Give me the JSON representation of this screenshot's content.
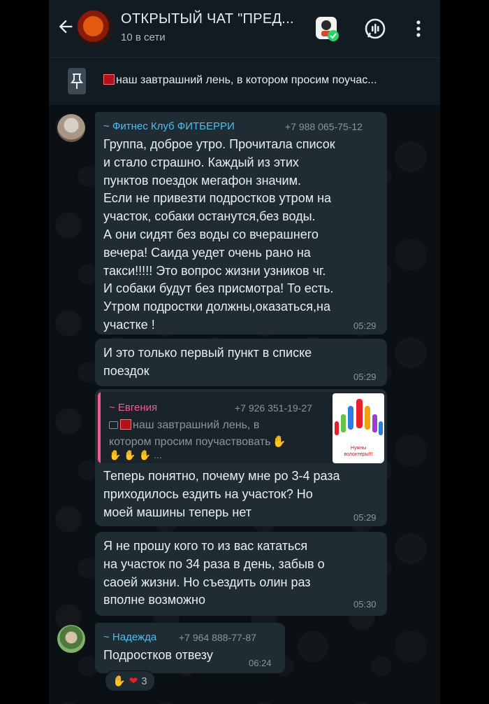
{
  "header": {
    "title": "ОТКРЫТЫЙ ЧАТ \"ПРЕД...",
    "subtitle": "10 в сети"
  },
  "pinned": {
    "text": "наш завтрашний лень, в котором просим поучас..."
  },
  "messages": [
    {
      "sender": "~ Фитнес Клуб ФИТБЕРРИ",
      "phone": "+7 988 065-75-12",
      "text": "Группа, доброе утро. Прочитала список\nи стало страшно. Каждый из этих\nпунктов поездок мегафон значим.\nЕсли не привезти подростков утром на\nучасток, собаки останутся,без воды.\nА они сидят без воды со вчерашнего\nвечера! Саида уедет очень рано на\nтакси!!!!! Это вопрос жизни узников чг.\nИ собаки будут без присмотра! То есть.\nУтром подростки должны,оказаться,на\nучастке !",
      "time": "05:29"
    },
    {
      "text": "И это только первый пункт в списке\nпоездок",
      "time": "05:29"
    },
    {
      "quote_sender": "~ Евгения",
      "quote_phone": "+7 926 351-19-27",
      "quote_text_1": "наш завтрашний лень, в",
      "quote_text_2": "котором просим поучаствовать",
      "quote_text_3": "...",
      "quote_image_caption": "Нужны волонтеры!!!",
      "text": "Теперь понятно, почему мне ро 3-4 раза\nприходилось ездить на участок? Но\nмоей машины теперь нет",
      "time": "05:29"
    },
    {
      "text": "Я не прошу кого то из вас кататься\nна участок по 34 раза в день, забыв о\nсаоей жизни. Но  съездить олин раз\nвполне возможно",
      "time": "05:30"
    },
    {
      "sender": "~ Надежда",
      "phone": "+7 964 888-77-87",
      "text": "Подростков отвезу",
      "time": "06:24",
      "reaction_count": "3"
    }
  ],
  "colors": {
    "background": "#0b1014",
    "bubble": "#1f2c34",
    "header": "#121b22",
    "sender_fitness": "#53bdeb",
    "sender_evgenia": "#f15c8f",
    "sender_nadezhda": "#53bdeb",
    "reply_bar": "#f15c8f"
  },
  "icons": [
    "back-arrow-icon",
    "group-avatar",
    "profile-badge-icon",
    "voice-chat-icon",
    "more-vert-icon",
    "pin-icon",
    "heart-icon",
    "pray-icon",
    "image-icon"
  ]
}
